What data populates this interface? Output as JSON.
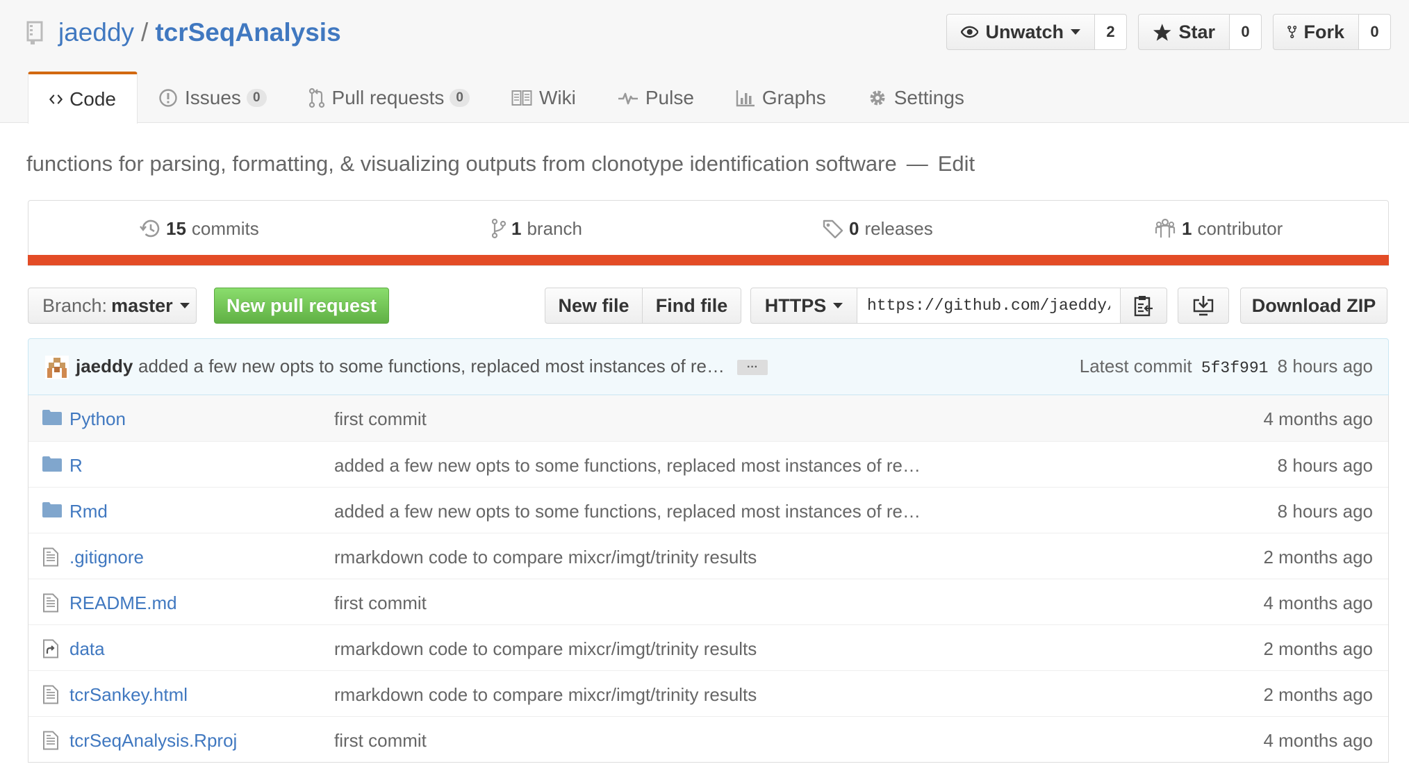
{
  "repo": {
    "owner": "jaeddy",
    "separator": "/",
    "name": "tcrSeqAnalysis",
    "description": "functions for parsing, formatting, & visualizing outputs from clonotype identification software",
    "description_dash": "—",
    "edit_label": "Edit"
  },
  "actions": {
    "watch": {
      "label": "Unwatch",
      "count": "2",
      "icon": "eye-icon"
    },
    "star": {
      "label": "Star",
      "count": "0",
      "icon": "star-icon"
    },
    "fork": {
      "label": "Fork",
      "count": "0",
      "icon": "fork-icon"
    }
  },
  "tabs": [
    {
      "label": "Code",
      "icon": "code-icon",
      "selected": true
    },
    {
      "label": "Issues",
      "count": "0",
      "icon": "issue-icon"
    },
    {
      "label": "Pull requests",
      "count": "0",
      "icon": "pull-request-icon"
    },
    {
      "label": "Wiki",
      "icon": "book-icon"
    },
    {
      "label": "Pulse",
      "icon": "pulse-icon"
    },
    {
      "label": "Graphs",
      "icon": "graph-icon"
    },
    {
      "label": "Settings",
      "icon": "gear-icon"
    }
  ],
  "summary": {
    "commits_count": "15",
    "commits_label": "commits",
    "branches_count": "1",
    "branches_label": "branch",
    "releases_count": "0",
    "releases_label": "releases",
    "contributors_count": "1",
    "contributors_label": "contributor",
    "language_color": "#e34c26"
  },
  "toolbar": {
    "branch_prefix": "Branch:",
    "branch_name": "master",
    "new_pull_request": "New pull request",
    "new_file": "New file",
    "find_file": "Find file",
    "protocol": "HTTPS",
    "clone_url": "https://github.com/jaeddy/tcrSeqAnalysis.git",
    "download_zip": "Download ZIP"
  },
  "latest_commit": {
    "author": "jaeddy",
    "message": "added a few new opts to some functions, replaced most instances of re…",
    "ellipsis": "···",
    "prefix": "Latest commit",
    "sha": "5f3f991",
    "age": "8 hours ago"
  },
  "files": [
    {
      "type": "directory",
      "icon": "folder-icon",
      "name": "Python",
      "message": "first commit",
      "age": "4 months ago"
    },
    {
      "type": "directory",
      "icon": "folder-icon",
      "name": "R",
      "message": "added a few new opts to some functions, replaced most instances of re…",
      "age": "8 hours ago"
    },
    {
      "type": "directory",
      "icon": "folder-icon",
      "name": "Rmd",
      "message": "added a few new opts to some functions, replaced most instances of re…",
      "age": "8 hours ago"
    },
    {
      "type": "file",
      "icon": "file-text-icon",
      "name": ".gitignore",
      "message": "rmarkdown code to compare mixcr/imgt/trinity results",
      "age": "2 months ago"
    },
    {
      "type": "file",
      "icon": "file-text-icon",
      "name": "README.md",
      "message": "first commit",
      "age": "4 months ago"
    },
    {
      "type": "symlink",
      "icon": "file-symlink-icon",
      "name": "data",
      "message": "rmarkdown code to compare mixcr/imgt/trinity results",
      "age": "2 months ago"
    },
    {
      "type": "file",
      "icon": "file-text-icon",
      "name": "tcrSankey.html",
      "message": "rmarkdown code to compare mixcr/imgt/trinity results",
      "age": "2 months ago"
    },
    {
      "type": "file",
      "icon": "file-text-icon",
      "name": "tcrSeqAnalysis.Rproj",
      "message": "first commit",
      "age": "4 months ago"
    }
  ]
}
